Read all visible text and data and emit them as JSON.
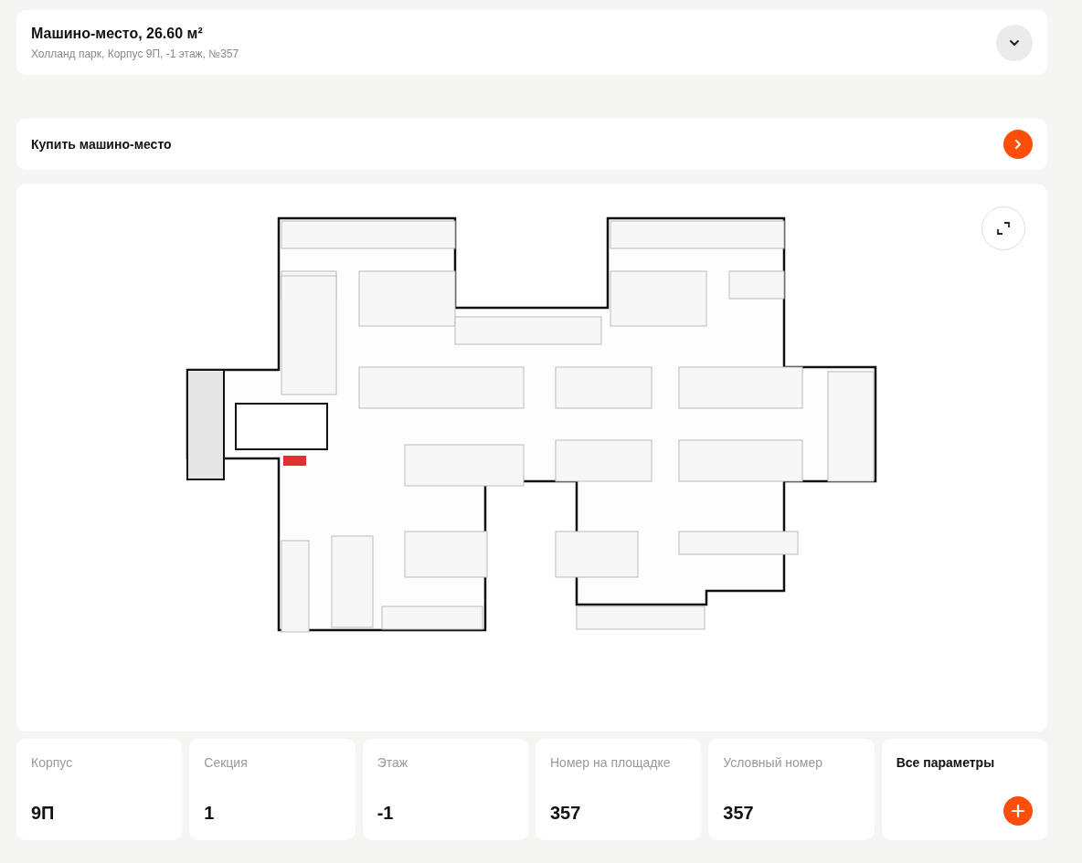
{
  "header": {
    "title": "Машино-место, 26.60 м²",
    "subtitle": "Холланд парк, Корпус 9П, -1 этаж, №357"
  },
  "buy": {
    "label": "Купить машино-место"
  },
  "params": [
    {
      "label": "Корпус",
      "value": "9П"
    },
    {
      "label": "Секция",
      "value": "1"
    },
    {
      "label": "Этаж",
      "value": "-1"
    },
    {
      "label": "Номер на площадке",
      "value": "357"
    },
    {
      "label": "Условный номер",
      "value": "357"
    }
  ],
  "all_params": {
    "label": "Все параметры"
  }
}
